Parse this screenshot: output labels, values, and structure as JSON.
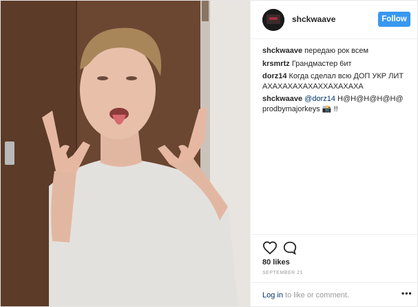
{
  "post": {
    "author": "shckwaave",
    "follow_label": "Follow",
    "likes_text": "80 likes",
    "date_text": "SEPTEMBER 21",
    "login_link": "Log in",
    "login_suffix": " to like or comment.",
    "more_label": "•••"
  },
  "comments": [
    {
      "user": "shckwaave",
      "text": "передаю рок всем"
    },
    {
      "user": "krsmrtz",
      "text": "Грандмастер 6ит"
    },
    {
      "user": "dorz14",
      "text": "Когда сделал всю ДОП УКР ЛИТ АХАХАХАХАХАХХАХАХАХА"
    },
    {
      "user": "shckwaave",
      "mention": "@dorz14",
      "text": "Н@Н@Н@Н@Н@ prodbymajorkeys 📸 !!"
    }
  ],
  "colors": {
    "accent": "#3897f0",
    "link": "#003569",
    "muted": "#999999",
    "text": "#262626"
  },
  "icons": [
    "heart-icon",
    "comment-icon",
    "more-options-icon"
  ]
}
